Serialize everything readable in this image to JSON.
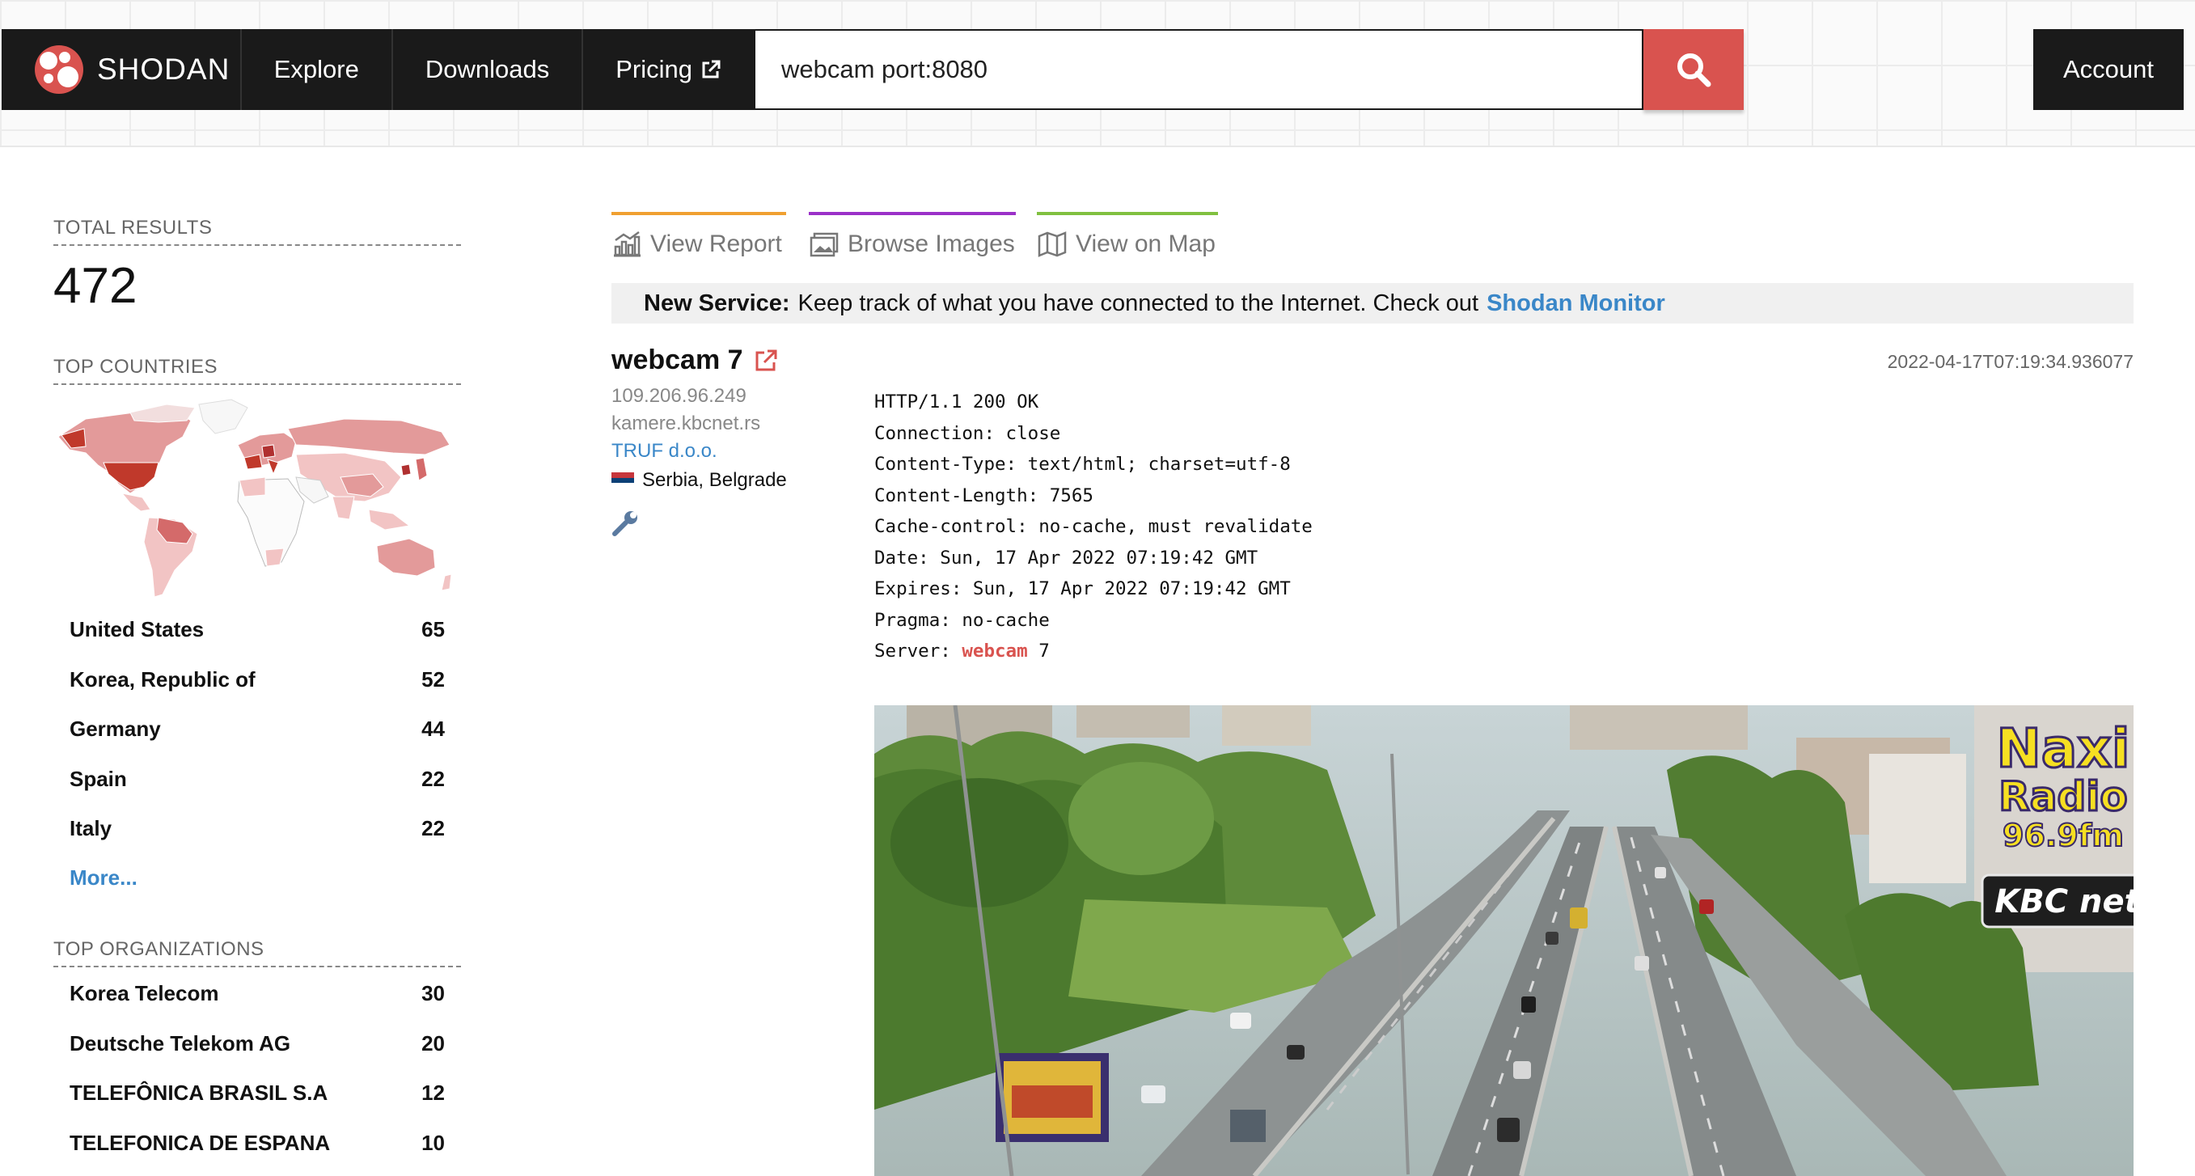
{
  "header": {
    "logo_text": "SHODAN",
    "nav": [
      {
        "label": "Explore"
      },
      {
        "label": "Downloads"
      },
      {
        "label": "Pricing",
        "external": true
      }
    ],
    "search": {
      "value": "webcam port:8080",
      "icon": "search-icon"
    },
    "account_label": "Account"
  },
  "sidebar": {
    "total_results_label": "TOTAL RESULTS",
    "total_results": "472",
    "top_countries_label": "TOP COUNTRIES",
    "countries": [
      {
        "name": "United States",
        "count": "65"
      },
      {
        "name": "Korea, Republic of",
        "count": "52"
      },
      {
        "name": "Germany",
        "count": "44"
      },
      {
        "name": "Spain",
        "count": "22"
      },
      {
        "name": "Italy",
        "count": "22"
      }
    ],
    "more_label": "More...",
    "top_orgs_label": "TOP ORGANIZATIONS",
    "orgs": [
      {
        "name": "Korea Telecom",
        "count": "30"
      },
      {
        "name": "Deutsche Telekom AG",
        "count": "20"
      },
      {
        "name": "TELEFÔNICA BRASIL S.A",
        "count": "12"
      },
      {
        "name": "TELEFONICA DE ESPANA",
        "count": "10"
      }
    ]
  },
  "tabs": [
    {
      "label": "View Report",
      "icon": "report-chart-icon",
      "color": "#f0a030"
    },
    {
      "label": "Browse Images",
      "icon": "images-icon",
      "color": "#9b30c8"
    },
    {
      "label": "View on Map",
      "icon": "map-icon",
      "color": "#80c040"
    }
  ],
  "notice": {
    "bold": "New Service:",
    "text": "Keep track of what you have connected to the Internet. Check out",
    "link": "Shodan Monitor"
  },
  "result": {
    "title": "webcam 7",
    "ip": "109.206.96.249",
    "hostname": "kamere.kbcnet.rs",
    "org": "TRUF d.o.o.",
    "location": "Serbia, Belgrade",
    "timestamp": "2022-04-17T07:19:34.936077",
    "banner": [
      "HTTP/1.1 200 OK",
      "Connection: close",
      "Content-Type: text/html; charset=utf-8",
      "Content-Length: 7565",
      "Cache-control: no-cache, must revalidate",
      "Date: Sun, 17 Apr 2022 07:19:42 GMT",
      "Expires: Sun, 17 Apr 2022 07:19:42 GMT",
      "Pragma: no-cache"
    ],
    "server_prefix": "Server: ",
    "server_highlight": "webcam",
    "server_suffix": " 7",
    "camera_overlay": {
      "line1": "Naxi",
      "line2": "Radio",
      "line3": "96.9fm",
      "brand": "KBC net"
    }
  },
  "colors": {
    "accent": "#d9534f",
    "link": "#3a87c8",
    "navbar": "#1a1a1a"
  }
}
